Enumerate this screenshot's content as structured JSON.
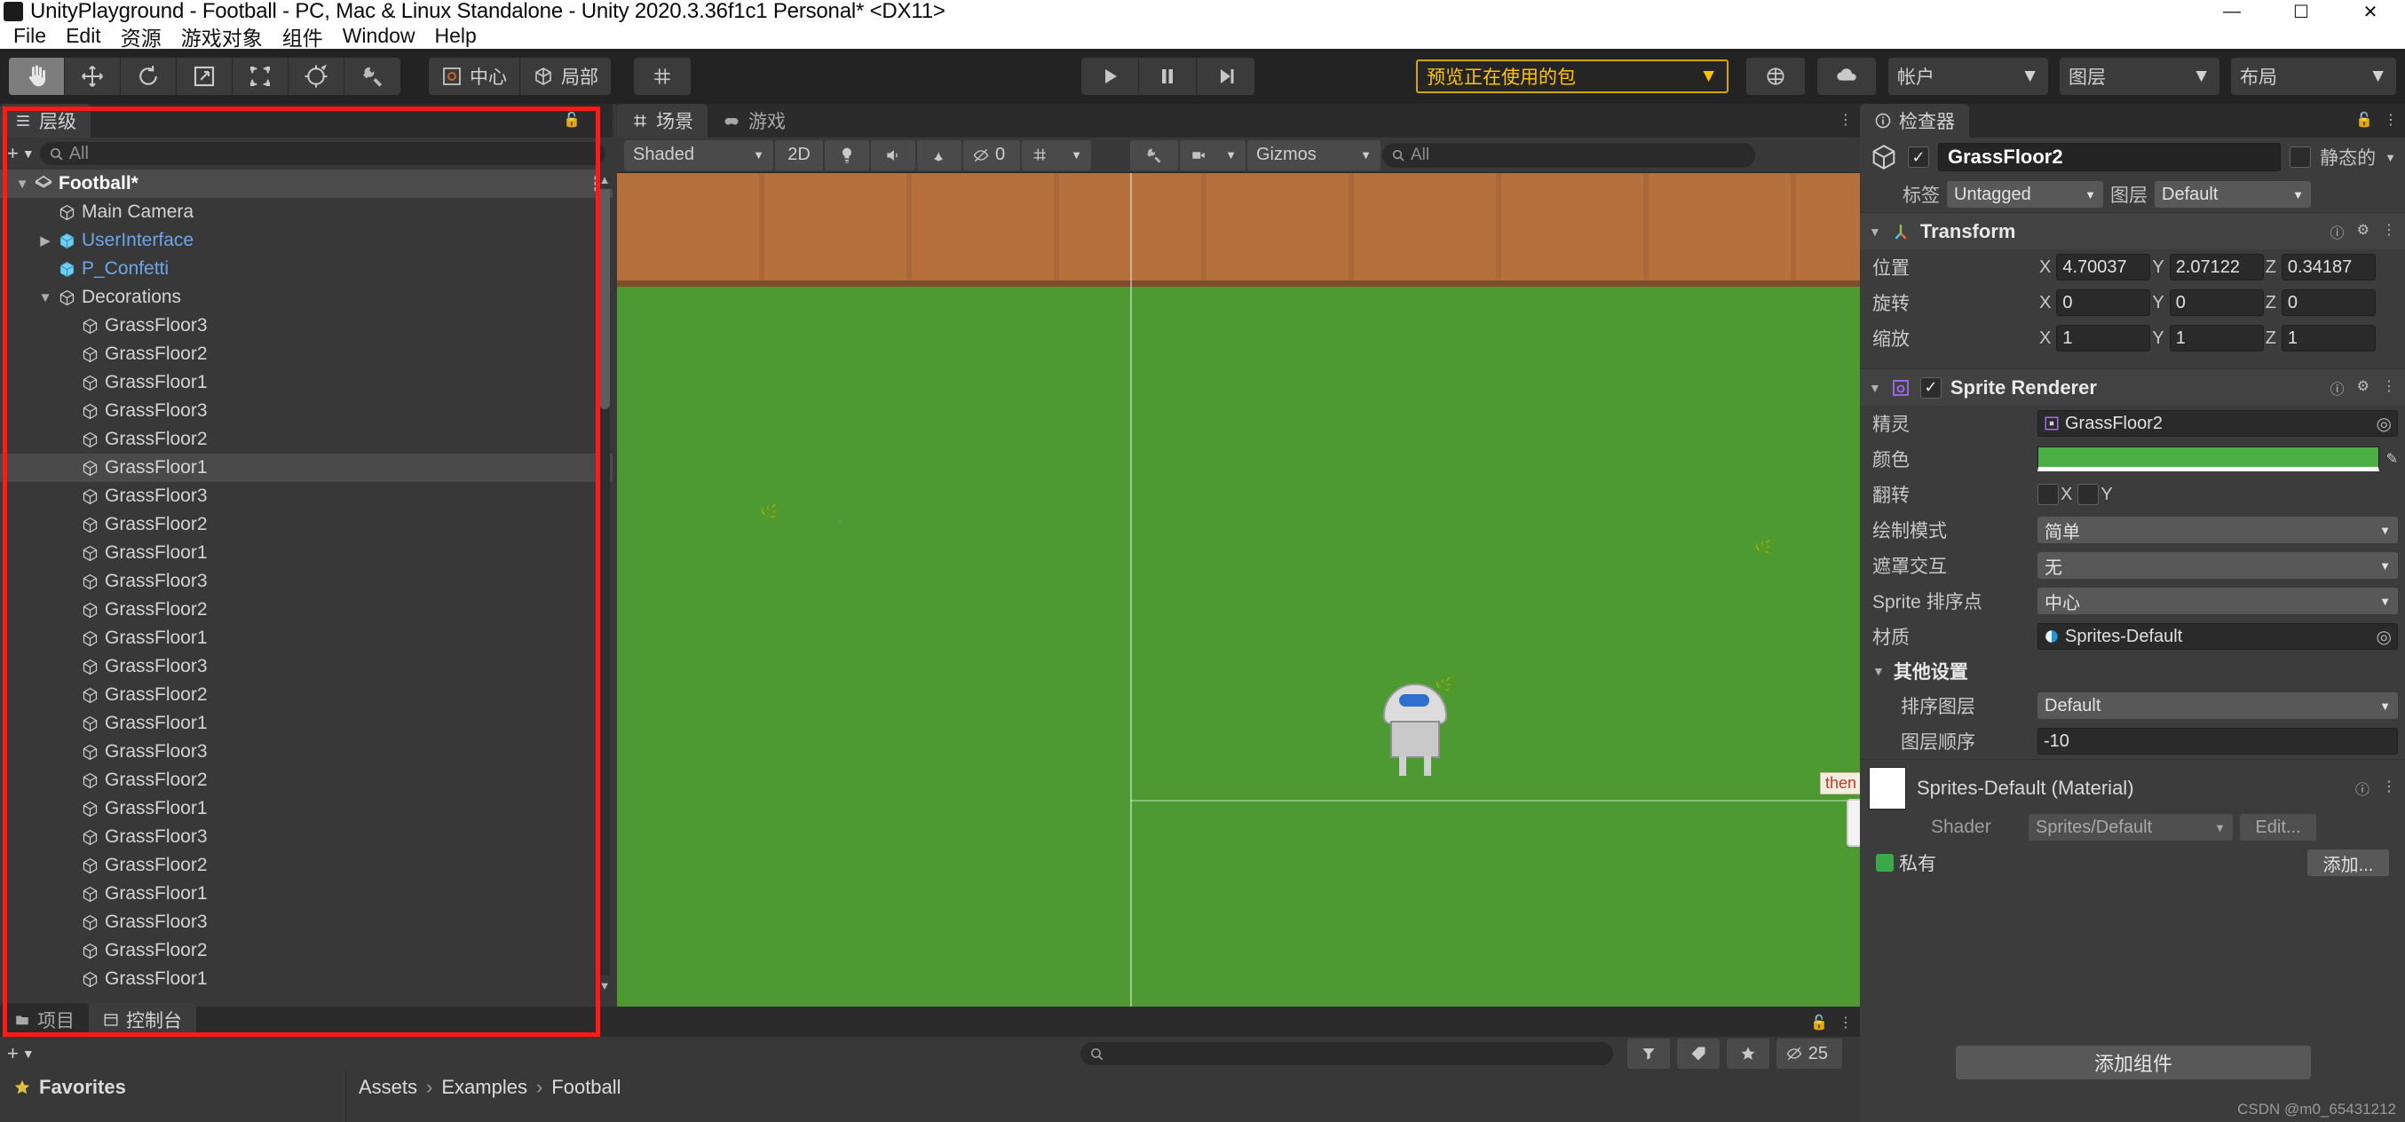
{
  "window": {
    "title": "UnityPlayground - Football - PC, Mac & Linux Standalone - Unity 2020.3.36f1c1 Personal* <DX11>",
    "minimize": "—",
    "maximize": "☐",
    "close": "✕"
  },
  "menubar": {
    "items": [
      "File",
      "Edit",
      "资源",
      "游戏对象",
      "组件",
      "Window",
      "Help"
    ]
  },
  "toolbar": {
    "tools": [
      {
        "name": "hand-tool",
        "icon": "hand",
        "active": true
      },
      {
        "name": "move-tool",
        "icon": "move",
        "active": false
      },
      {
        "name": "rotate-tool",
        "icon": "rotate",
        "active": false
      },
      {
        "name": "scale-tool",
        "icon": "scale",
        "active": false
      },
      {
        "name": "rect-tool",
        "icon": "rect",
        "active": false
      },
      {
        "name": "transform-tool",
        "icon": "transform",
        "active": false
      },
      {
        "name": "custom-editor-tool",
        "icon": "wrench",
        "active": false
      }
    ],
    "pivot_mode": "中心",
    "pivot_rotation": "局部",
    "grid_label": "grid-snap-icon",
    "play": "▶",
    "pause": "⏸",
    "step": "⏭",
    "package_preview": "预览正在使用的包",
    "collab_icon": "collab-icon",
    "cloud_icon": "cloud-icon",
    "account": "帐户",
    "layers": "图层",
    "layout": "布局"
  },
  "hierarchy": {
    "tab": "层级",
    "search_placeholder": "All",
    "add_label": "+",
    "items": [
      {
        "label": "Football*",
        "depth": 0,
        "icon": "unity-scene-icon",
        "expanded": true,
        "root": true,
        "prefab": false,
        "selected": false,
        "more": true
      },
      {
        "label": "Main Camera",
        "depth": 1,
        "icon": "gameobject-icon",
        "expanded": null,
        "root": false,
        "prefab": false,
        "selected": false
      },
      {
        "label": "UserInterface",
        "depth": 1,
        "icon": "prefab-icon",
        "expanded": false,
        "root": false,
        "prefab": true,
        "selected": false,
        "arrow": true
      },
      {
        "label": "P_Confetti",
        "depth": 1,
        "icon": "prefab-icon",
        "expanded": null,
        "root": false,
        "prefab": true,
        "selected": false,
        "arrow": true
      },
      {
        "label": "Decorations",
        "depth": 1,
        "icon": "gameobject-icon",
        "expanded": true,
        "root": false,
        "prefab": false,
        "selected": false
      },
      {
        "label": "GrassFloor3",
        "depth": 2,
        "icon": "gameobject-icon",
        "root": false,
        "prefab": false,
        "selected": false
      },
      {
        "label": "GrassFloor2",
        "depth": 2,
        "icon": "gameobject-icon",
        "root": false,
        "prefab": false,
        "selected": false
      },
      {
        "label": "GrassFloor1",
        "depth": 2,
        "icon": "gameobject-icon",
        "root": false,
        "prefab": false,
        "selected": false
      },
      {
        "label": "GrassFloor3",
        "depth": 2,
        "icon": "gameobject-icon",
        "root": false,
        "prefab": false,
        "selected": false
      },
      {
        "label": "GrassFloor2",
        "depth": 2,
        "icon": "gameobject-icon",
        "root": false,
        "prefab": false,
        "selected": false
      },
      {
        "label": "GrassFloor1",
        "depth": 2,
        "icon": "gameobject-icon",
        "root": false,
        "prefab": false,
        "selected": true
      },
      {
        "label": "GrassFloor3",
        "depth": 2,
        "icon": "gameobject-icon",
        "root": false,
        "prefab": false,
        "selected": false
      },
      {
        "label": "GrassFloor2",
        "depth": 2,
        "icon": "gameobject-icon",
        "root": false,
        "prefab": false,
        "selected": false
      },
      {
        "label": "GrassFloor1",
        "depth": 2,
        "icon": "gameobject-icon",
        "root": false,
        "prefab": false,
        "selected": false
      },
      {
        "label": "GrassFloor3",
        "depth": 2,
        "icon": "gameobject-icon",
        "root": false,
        "prefab": false,
        "selected": false
      },
      {
        "label": "GrassFloor2",
        "depth": 2,
        "icon": "gameobject-icon",
        "root": false,
        "prefab": false,
        "selected": false
      },
      {
        "label": "GrassFloor1",
        "depth": 2,
        "icon": "gameobject-icon",
        "root": false,
        "prefab": false,
        "selected": false
      },
      {
        "label": "GrassFloor3",
        "depth": 2,
        "icon": "gameobject-icon",
        "root": false,
        "prefab": false,
        "selected": false
      },
      {
        "label": "GrassFloor2",
        "depth": 2,
        "icon": "gameobject-icon",
        "root": false,
        "prefab": false,
        "selected": false
      },
      {
        "label": "GrassFloor1",
        "depth": 2,
        "icon": "gameobject-icon",
        "root": false,
        "prefab": false,
        "selected": false
      },
      {
        "label": "GrassFloor3",
        "depth": 2,
        "icon": "gameobject-icon",
        "root": false,
        "prefab": false,
        "selected": false
      },
      {
        "label": "GrassFloor2",
        "depth": 2,
        "icon": "gameobject-icon",
        "root": false,
        "prefab": false,
        "selected": false
      },
      {
        "label": "GrassFloor1",
        "depth": 2,
        "icon": "gameobject-icon",
        "root": false,
        "prefab": false,
        "selected": false
      },
      {
        "label": "GrassFloor3",
        "depth": 2,
        "icon": "gameobject-icon",
        "root": false,
        "prefab": false,
        "selected": false
      },
      {
        "label": "GrassFloor2",
        "depth": 2,
        "icon": "gameobject-icon",
        "root": false,
        "prefab": false,
        "selected": false
      },
      {
        "label": "GrassFloor1",
        "depth": 2,
        "icon": "gameobject-icon",
        "root": false,
        "prefab": false,
        "selected": false
      },
      {
        "label": "GrassFloor3",
        "depth": 2,
        "icon": "gameobject-icon",
        "root": false,
        "prefab": false,
        "selected": false
      },
      {
        "label": "GrassFloor2",
        "depth": 2,
        "icon": "gameobject-icon",
        "root": false,
        "prefab": false,
        "selected": false
      },
      {
        "label": "GrassFloor1",
        "depth": 2,
        "icon": "gameobject-icon",
        "root": false,
        "prefab": false,
        "selected": false
      }
    ]
  },
  "scene": {
    "tabs": [
      {
        "label": "场景",
        "icon": "scene-icon",
        "active": true
      },
      {
        "label": "游戏",
        "icon": "game-icon",
        "active": false
      }
    ],
    "shading_mode": "Shaded",
    "mode_2d": "2D",
    "lighting_icon": "lighting-icon",
    "audio_icon": "audio-icon",
    "fx_icon": "fx-icon",
    "hidden_count": "0",
    "grid_icon": "grid-y-icon",
    "tools_icon": "scene-tools-icon",
    "camera_icon": "scene-camera-icon",
    "gizmos": "Gizmos",
    "search_placeholder": "All"
  },
  "project": {
    "tabs": [
      {
        "label": "项目",
        "icon": "project-icon",
        "active": false
      },
      {
        "label": "控制台",
        "icon": "console-icon",
        "active": true
      }
    ],
    "add_label": "+",
    "search_placeholder": "",
    "favorites": "Favorites",
    "breadcrumbs": [
      "Assets",
      "Examples",
      "Football"
    ],
    "view_count": "25"
  },
  "inspector": {
    "tab": "检查器",
    "object_name": "GrassFloor2",
    "enabled": true,
    "static_label": "静态的",
    "static_checked": false,
    "tag_label": "标签",
    "tag_value": "Untagged",
    "layer_label": "图层",
    "layer_value": "Default",
    "transform": {
      "title": "Transform",
      "rows": [
        {
          "label": "位置",
          "x": "4.70037",
          "y": "2.07122",
          "z": "0.34187"
        },
        {
          "label": "旋转",
          "x": "0",
          "y": "0",
          "z": "0"
        },
        {
          "label": "缩放",
          "x": "1",
          "y": "1",
          "z": "1"
        }
      ]
    },
    "sprite_renderer": {
      "title": "Sprite Renderer",
      "enabled": true,
      "sprite_label": "精灵",
      "sprite_value": "GrassFloor2",
      "color_label": "颜色",
      "color_value": "#4CAF45",
      "flip_label": "翻转",
      "flip_x": "X",
      "flip_y": "Y",
      "draw_mode_label": "绘制模式",
      "draw_mode_value": "简单",
      "mask_label": "遮罩交互",
      "mask_value": "无",
      "sort_point_label": "Sprite 排序点",
      "sort_point_value": "中心",
      "material_label": "材质",
      "material_value": "Sprites-Default"
    },
    "additional": {
      "title": "其他设置",
      "sorting_layer_label": "排序图层",
      "sorting_layer_value": "Default",
      "order_label": "图层顺序",
      "order_value": "-10"
    },
    "material": {
      "title": "Sprites-Default (Material)",
      "shader_label": "Shader",
      "shader_value": "Sprites/Default",
      "edit_label": "Edit...",
      "private_label": "私有",
      "private_checked": true,
      "add_label": "添加..."
    },
    "add_component": "添加组件"
  },
  "watermark": "CSDN @m0_65431212"
}
